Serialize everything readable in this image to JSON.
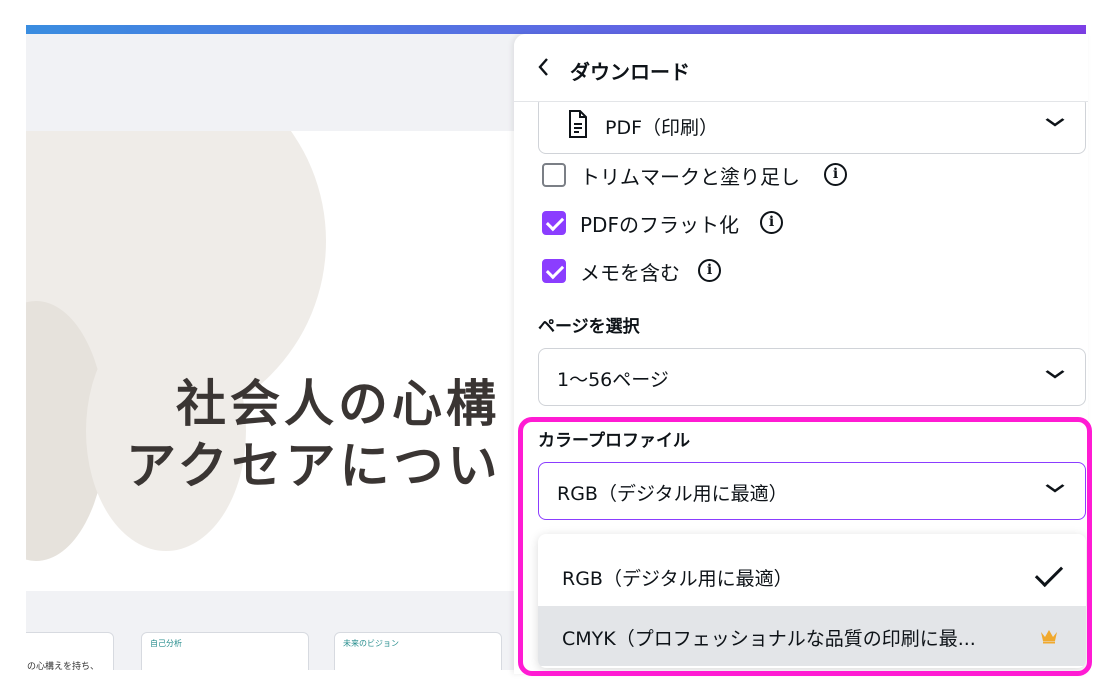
{
  "colors": {
    "accent": "#8b3dff",
    "highlight": "#ff1bd3",
    "crown": "#f0a92e"
  },
  "slide": {
    "title_line1": "社会人の心構",
    "title_line2": "アクセアについ"
  },
  "thumbnails": [
    {
      "title": "",
      "body": "の心構えを持ち、"
    },
    {
      "title": "自己分析",
      "body": ""
    },
    {
      "title": "未来のビジョン",
      "body": ""
    }
  ],
  "panel": {
    "back_icon": "chevron-left-icon",
    "title": "ダウンロード",
    "file_type": {
      "value": "PDF（印刷）",
      "icon": "document-icon"
    },
    "options": [
      {
        "label": "トリムマークと塗り足し",
        "checked": false
      },
      {
        "label": "PDFのフラット化",
        "checked": true
      },
      {
        "label": "メモを含む",
        "checked": true
      }
    ],
    "page_select": {
      "label": "ページを選択",
      "value": "1〜56ページ"
    },
    "color_profile": {
      "label": "カラープロファイル",
      "value": "RGB（デジタル用に最適）",
      "menu": [
        {
          "label": "RGB（デジタル用に最適）",
          "selected": true
        },
        {
          "label": "CMYK（プロフェッショナルな品質の印刷に最...",
          "premium": true,
          "icon": "crown-icon"
        }
      ]
    }
  }
}
